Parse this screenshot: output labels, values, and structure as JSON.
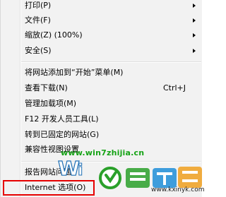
{
  "menu": {
    "items": [
      {
        "label": "打印(P)",
        "shortcut": "",
        "submenu": true
      },
      {
        "label": "文件(F)",
        "shortcut": "",
        "submenu": true
      },
      {
        "label": "缩放(Z) (100%)",
        "shortcut": "",
        "submenu": true
      },
      {
        "label": "安全(S)",
        "shortcut": "",
        "submenu": true
      },
      {
        "label": "将网站添加到“开始”菜单(M)",
        "shortcut": "",
        "submenu": false
      },
      {
        "label": "查看下载(N)",
        "shortcut": "Ctrl+J",
        "submenu": false
      },
      {
        "label": "管理加载项(M)",
        "shortcut": "",
        "submenu": false
      },
      {
        "label": "F12 开发人员工具(L)",
        "shortcut": "",
        "submenu": false
      },
      {
        "label": "转到已固定的网站(G)",
        "shortcut": "",
        "submenu": false
      },
      {
        "label": "兼容性视图设置",
        "shortcut": "",
        "submenu": false
      },
      {
        "label": "报告网站问题",
        "shortcut": "",
        "submenu": false
      },
      {
        "label": "Internet 选项(O)",
        "shortcut": "",
        "submenu": false
      }
    ]
  },
  "watermark": {
    "url": "www.win7zhijia.cn",
    "site": "www.kxinyk.com",
    "accent_color": "#16a316",
    "highlight_color": "#e60000"
  }
}
